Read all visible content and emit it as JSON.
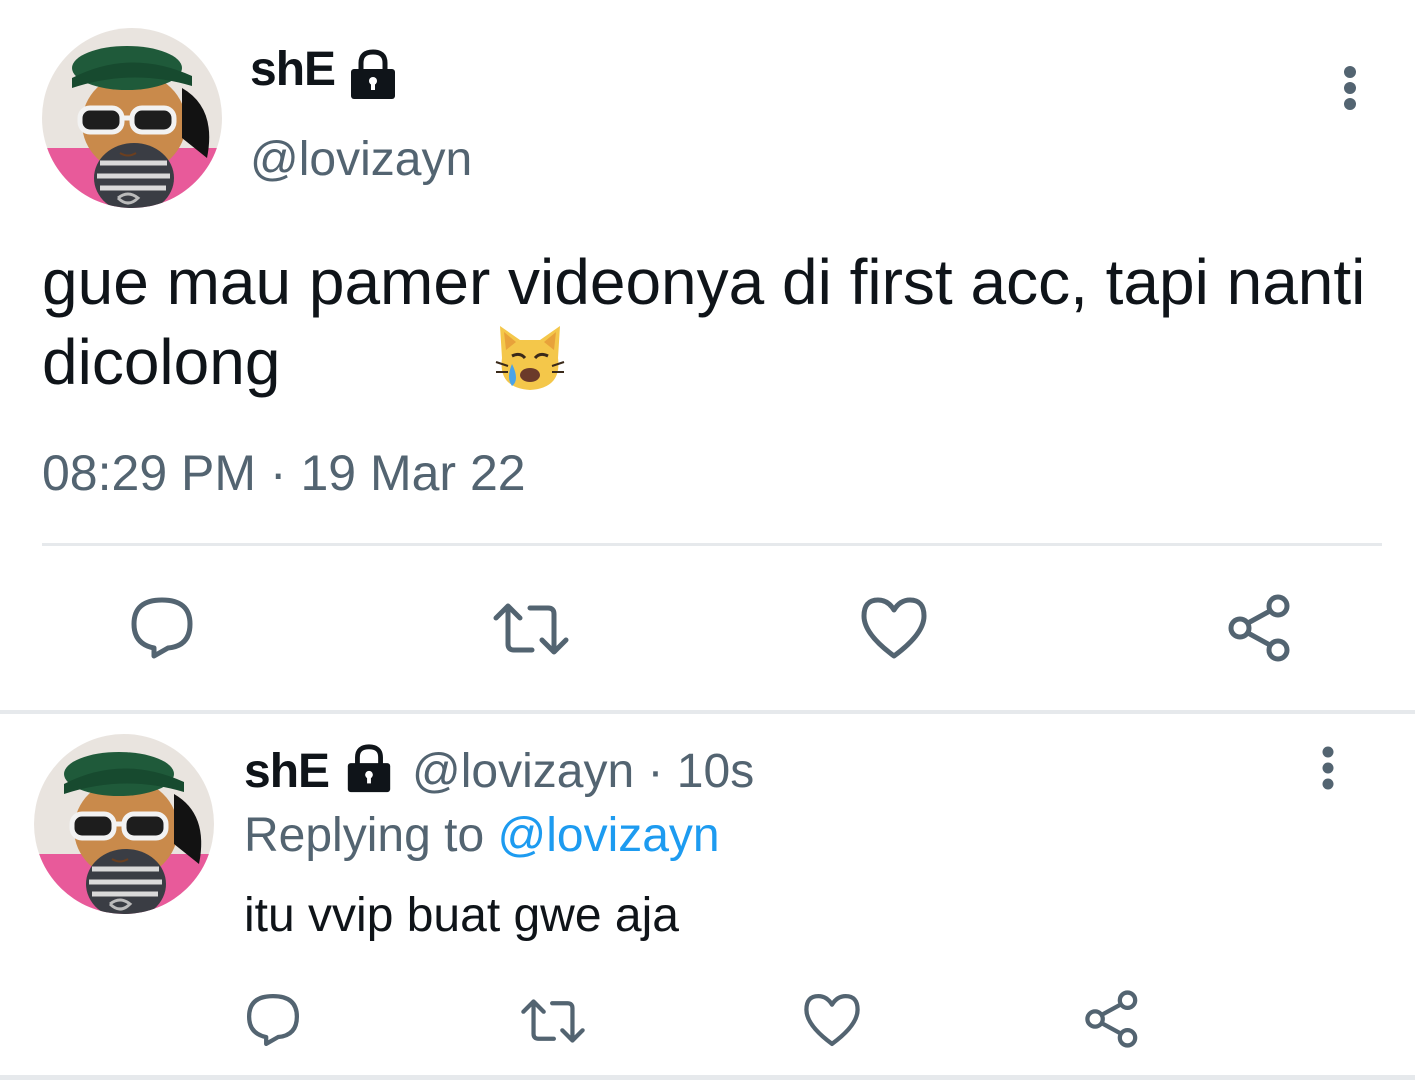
{
  "tweet": {
    "author_name": "shE",
    "author_handle": "@lovizayn",
    "text": "gue mau pamer videonya di first acc, tapi nanti dicolong",
    "emoji": "crying-cat-face",
    "timestamp": "08:29 PM · 19 Mar 22",
    "protected_icon": "lock-icon",
    "actions": [
      "reply-icon",
      "retweet-icon",
      "like-icon",
      "share-icon"
    ]
  },
  "reply": {
    "author_name": "shE",
    "author_handle": "@lovizayn",
    "time": "· 10s",
    "replying_prefix": "Replying to",
    "replying_to": "@lovizayn",
    "text": "itu vvip buat gwe aja",
    "actions": [
      "reply-icon",
      "retweet-icon",
      "like-icon",
      "share-icon"
    ]
  },
  "colors": {
    "text_primary": "#0f1419",
    "text_secondary": "#536471",
    "link": "#1d9bf0",
    "divider": "#e6e9ec",
    "icon": "#536471"
  }
}
